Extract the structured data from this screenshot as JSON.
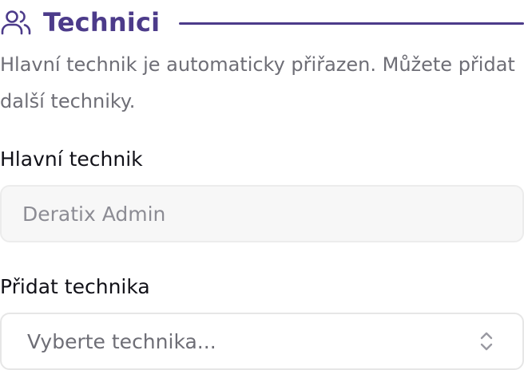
{
  "section": {
    "title": "Technici",
    "icon": "users-icon",
    "accent_color": "#4c3b8a",
    "description": "Hlavní technik je automaticky přiřazen. Můžete přidat další techniky."
  },
  "main_technician": {
    "label": "Hlavní technik",
    "value": "Deratix Admin"
  },
  "add_technician": {
    "label": "Přidat technika",
    "placeholder": "Vyberte technika...",
    "icon": "chevron-up-down-icon"
  }
}
